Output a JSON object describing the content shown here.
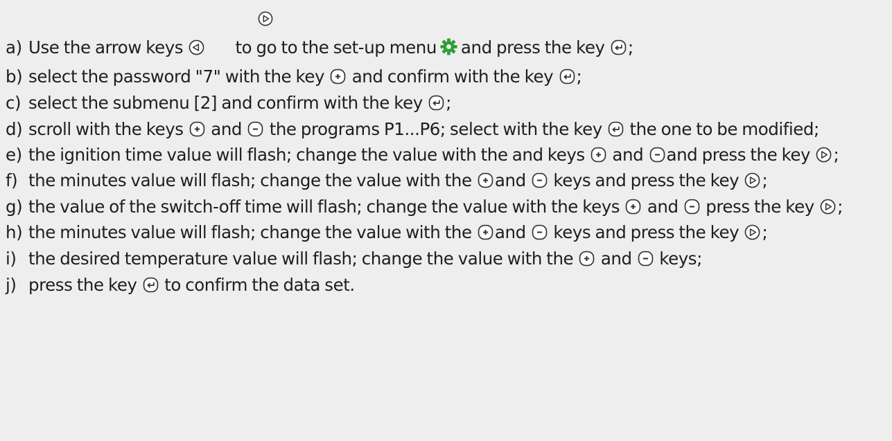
{
  "colors": {
    "text": "#1e1e1e",
    "key_stroke": "#333333",
    "gear": "#2f9e3a",
    "background": "#eeeeee"
  },
  "icons": {
    "floating": "play-key-icon",
    "play": "play-key-icon",
    "back": "back-key-icon",
    "plus": "plus-key-icon",
    "minus": "minus-key-icon",
    "enter": "enter-key-icon",
    "setup": "gear-icon"
  },
  "steps": [
    {
      "label": "a)",
      "parts": [
        "Use the arrow keys",
        "to go to the set-up menu",
        "and press the key",
        ";"
      ]
    },
    {
      "label": "b)",
      "parts": [
        "select the password \"7\" with the key",
        "and confirm with the key",
        ";"
      ]
    },
    {
      "label": "c)",
      "parts": [
        "select the submenu [2] and confirm with the key",
        ";"
      ]
    },
    {
      "label": "d)",
      "parts": [
        "scroll with the keys",
        "and",
        "the programs P1...P6; select with the key",
        "the one to be modified;"
      ]
    },
    {
      "label": "e)",
      "parts": [
        "the ignition time value will flash; change the value with the and keys",
        "and",
        "and press the key",
        ";"
      ]
    },
    {
      "label": "f)",
      "parts": [
        "the minutes value will flash; change the value with the",
        "and",
        "keys and press the key",
        ";"
      ]
    },
    {
      "label": "g)",
      "parts": [
        "the value of the switch-off time will flash; change the value with the keys",
        "and",
        "press the key",
        ";"
      ]
    },
    {
      "label": "h)",
      "parts": [
        "the minutes value will flash; change the value with the",
        "and",
        "keys and press the key",
        ";"
      ]
    },
    {
      "label": "i)",
      "parts": [
        "the desired temperature value will flash; change the value with the",
        "and",
        "keys;"
      ]
    },
    {
      "label": "j)",
      "parts": [
        "press the key",
        "to confirm the data set."
      ]
    }
  ]
}
